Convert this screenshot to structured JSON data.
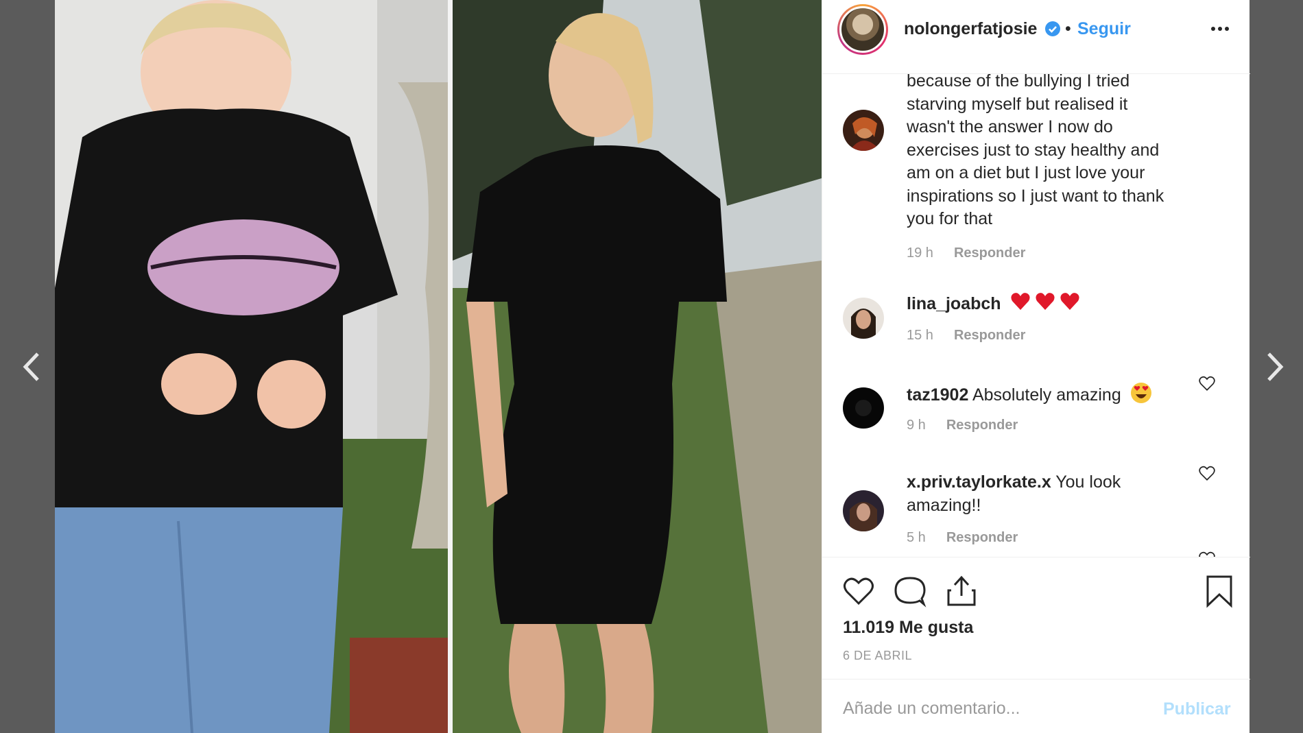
{
  "navigation": {
    "prev_icon": "chevron-left-icon",
    "next_icon": "chevron-right-icon"
  },
  "post": {
    "images": [
      {
        "name": "before-photo",
        "description_icon": "photo"
      },
      {
        "name": "after-photo",
        "description_icon": "photo"
      }
    ]
  },
  "header": {
    "username": "nolongerfatjosie",
    "verified": true,
    "separator": "•",
    "follow_label": "Seguir",
    "more_icon": "more-options-icon"
  },
  "comments": [
    {
      "user": "",
      "text": "because of the bullying I tried starving myself but realised it wasn't the answer I now do exercises just to stay healthy and am on a diet but I just love your inspirations so I just want to thank you for that",
      "lines": [
        "because of the bullying I tried",
        "starving myself but realised it",
        "wasn't the answer I now do",
        "exercises just to stay healthy and",
        "am on a diet but I just love your",
        "inspirations so I just want to thank",
        "you for that"
      ],
      "time": "19 h",
      "reply_label": "Responder"
    },
    {
      "user": "lina_joabch",
      "text": "",
      "emojis": [
        "red-heart",
        "red-heart",
        "red-heart"
      ],
      "time": "15 h",
      "reply_label": "Responder"
    },
    {
      "user": "taz1902",
      "text": "Absolutely amazing",
      "emojis": [
        "heart-eyes-face"
      ],
      "time": "9 h",
      "reply_label": "Responder"
    },
    {
      "user": "x.priv.taylorkate.x",
      "text": "You look",
      "text_line2": "amazing!!",
      "time": "5 h",
      "reply_label": "Responder"
    }
  ],
  "actions": {
    "like_icon": "heart-outline-icon",
    "comment_icon": "speech-bubble-icon",
    "share_icon": "share-upload-icon",
    "save_icon": "bookmark-icon"
  },
  "likes_text": "11.019 Me gusta",
  "date_text": "6 DE ABRIL",
  "comment_input": {
    "placeholder": "Añade un comentario...",
    "value": ""
  },
  "publish_label": "Publicar",
  "colors": {
    "backdrop": "#5b5b5b",
    "link_blue": "#3897f0",
    "publish_disabled": "#b2dffc",
    "text_primary": "#262626",
    "text_secondary": "#999999"
  }
}
